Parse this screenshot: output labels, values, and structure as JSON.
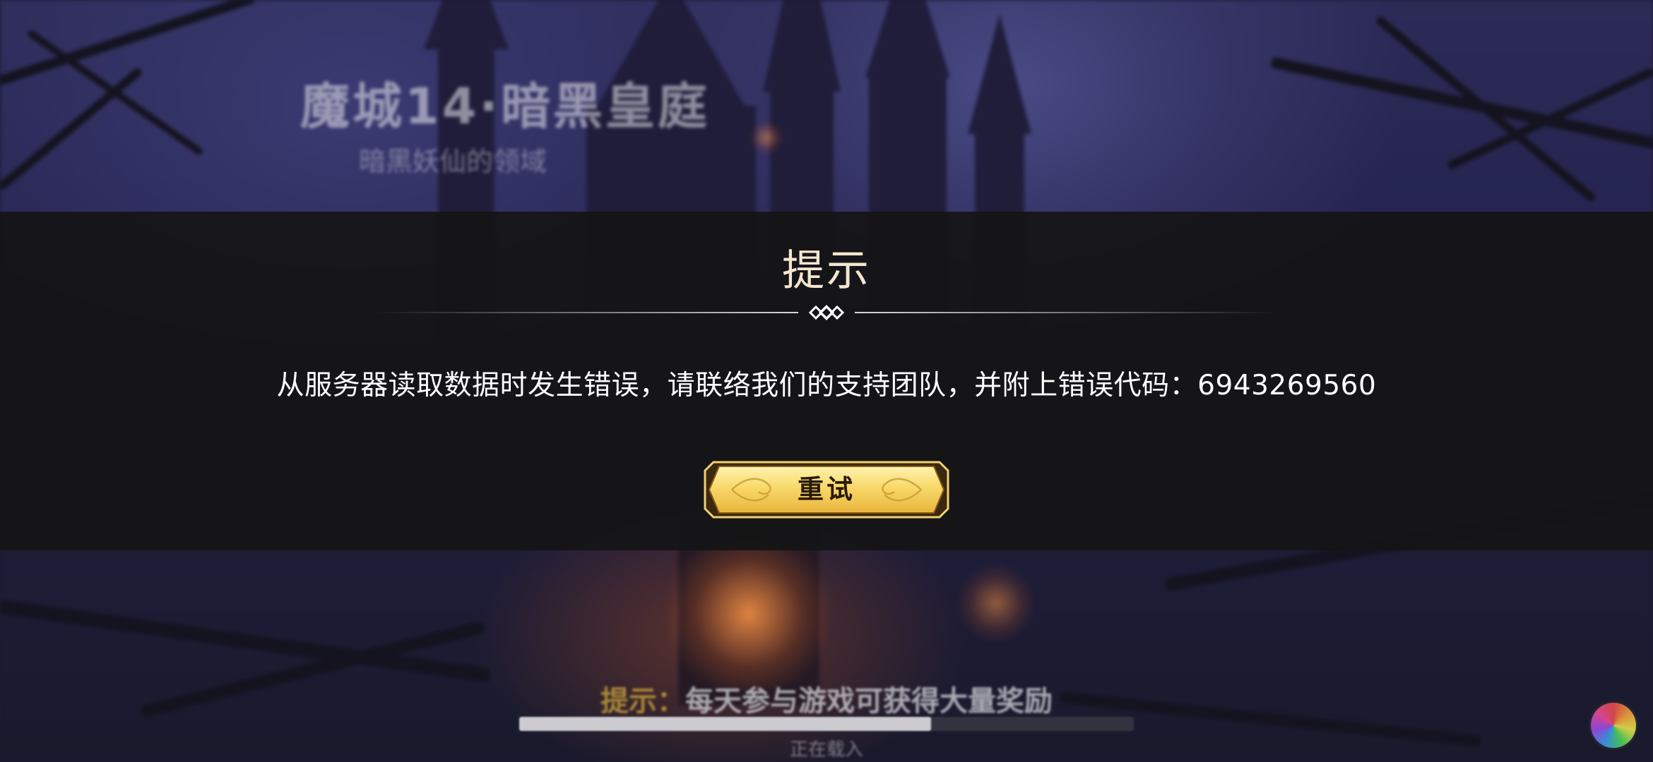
{
  "background": {
    "title": "魔城14·暗黑皇庭",
    "subtitle": "暗黑妖仙的领域"
  },
  "dialog": {
    "title": "提示",
    "message": "从服务器读取数据时发生错误，请联络我们的支持团队，并附上错误代码：6943269560",
    "retry_label": "重试"
  },
  "loading": {
    "tip_label": "提示：",
    "tip_text": "每天参与游戏可获得大量奖励",
    "progress": 0.67,
    "status_text": "正在载入"
  },
  "colors": {
    "dialog_background": "#141416",
    "title_color": "#f4e6cf",
    "button_gold": "#f5d266",
    "tip_label_gold": "#c8a03c"
  },
  "icons": [
    "divider-ornament-icon",
    "color-wheel-icon"
  ]
}
